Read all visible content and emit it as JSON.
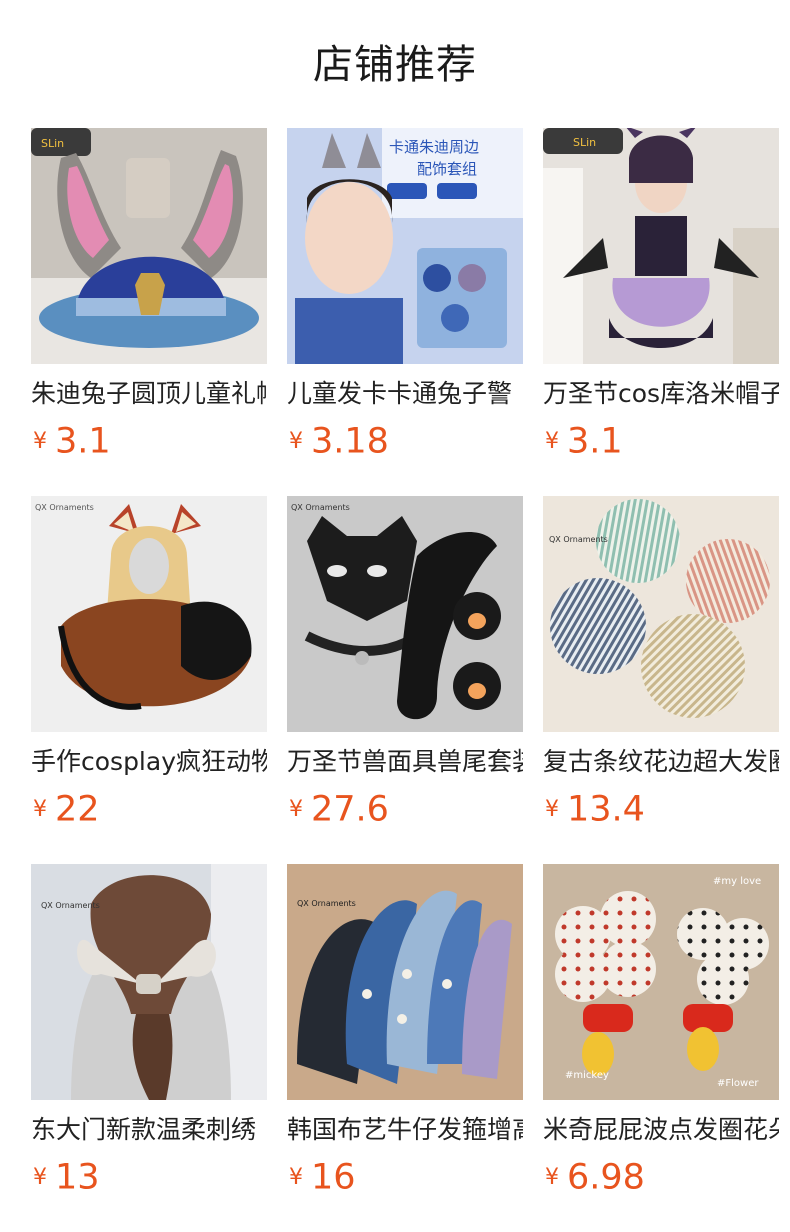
{
  "section": {
    "title": "店铺推荐"
  },
  "products": [
    {
      "name": "朱迪兔子圆顶儿童礼帽",
      "currency": "¥",
      "price": "3.1",
      "image_text": "SLin"
    },
    {
      "name": "儿童发卡卡通兔子警",
      "currency": "¥",
      "price": "3.18",
      "image_text": "卡通朱迪周边 配饰套组"
    },
    {
      "name": "万圣节cos库洛米帽子",
      "currency": "¥",
      "price": "3.1",
      "image_text": "SLin"
    },
    {
      "name": "手作cosplay疯狂动物",
      "currency": "¥",
      "price": "22",
      "image_text": "QX Ornaments"
    },
    {
      "name": "万圣节兽面具兽尾套装",
      "currency": "¥",
      "price": "27.6",
      "image_text": "QX Ornaments"
    },
    {
      "name": "复古条纹花边超大发圈",
      "currency": "¥",
      "price": "13.4",
      "image_text": "QX Ornaments"
    },
    {
      "name": "东大门新款温柔刺绣",
      "currency": "¥",
      "price": "13",
      "image_text": "QX Ornaments"
    },
    {
      "name": "韩国布艺牛仔发箍增高",
      "currency": "¥",
      "price": "16",
      "image_text": "QX Ornaments"
    },
    {
      "name": "米奇屁屁波点发圈花朵",
      "currency": "¥",
      "price": "6.98",
      "image_text": "#my love #mickey #Flower"
    }
  ],
  "colors": {
    "price": "#e8541e",
    "title": "#1a1a1a"
  }
}
